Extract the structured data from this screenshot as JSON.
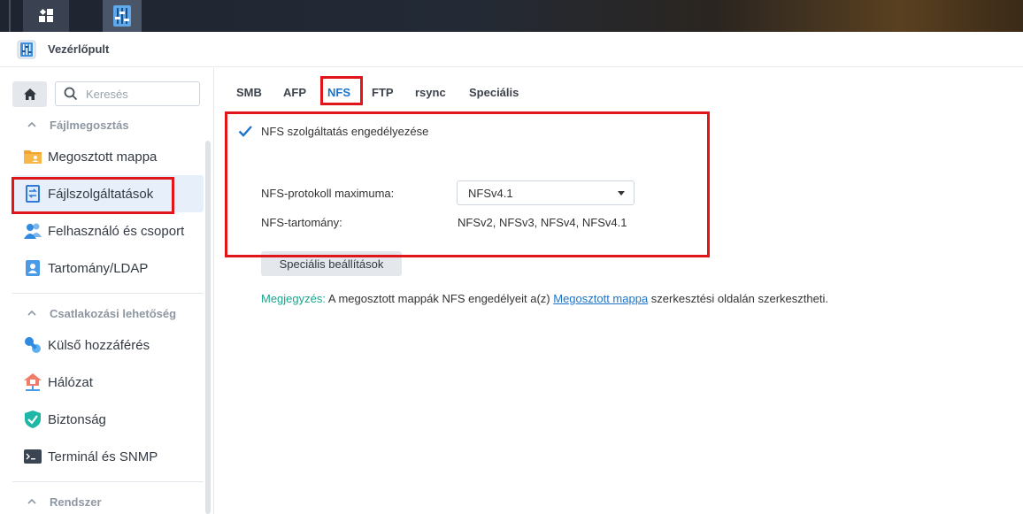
{
  "window": {
    "title": "Vezérlőpult"
  },
  "sidebar": {
    "search_placeholder": "Keresés",
    "sections": [
      {
        "label": "Fájlmegosztás"
      },
      {
        "label": "Csatlakozási lehetőség"
      },
      {
        "label": "Rendszer"
      }
    ],
    "items": [
      {
        "label": "Megosztott mappa",
        "icon": "folder-icon"
      },
      {
        "label": "Fájlszolgáltatások",
        "icon": "file-services-icon",
        "active": true
      },
      {
        "label": "Felhasználó és csoport",
        "icon": "users-icon"
      },
      {
        "label": "Tartomány/LDAP",
        "icon": "domain-icon"
      },
      {
        "label": "Külső hozzáférés",
        "icon": "external-access-icon"
      },
      {
        "label": "Hálózat",
        "icon": "network-icon"
      },
      {
        "label": "Biztonság",
        "icon": "shield-icon"
      },
      {
        "label": "Terminál és SNMP",
        "icon": "terminal-icon"
      }
    ]
  },
  "tabs": [
    {
      "label": "SMB"
    },
    {
      "label": "AFP"
    },
    {
      "label": "NFS",
      "active": true
    },
    {
      "label": "FTP"
    },
    {
      "label": "rsync"
    },
    {
      "label": "Speciális"
    }
  ],
  "nfs": {
    "enable_label": "NFS szolgáltatás engedélyezése",
    "enable_checked": true,
    "max_protocol_label": "NFS-protokoll maximuma:",
    "max_protocol_value": "NFSv4.1",
    "range_label": "NFS-tartomány:",
    "range_value": "NFSv2, NFSv3, NFSv4, NFSv4.1",
    "advanced_button": "Speciális beállítások"
  },
  "note": {
    "prefix": "Megjegyzés:",
    "text_before": " A megosztott mappák NFS engedélyeit a(z) ",
    "link": "Megosztott mappa",
    "text_after": " szerkesztési oldalán szerkesztheti."
  },
  "colors": {
    "accent": "#1b74c9",
    "note_highlight": "#1aa58d",
    "annotation_red": "#e0161b",
    "active_item_bg": "#e7f0fa"
  }
}
